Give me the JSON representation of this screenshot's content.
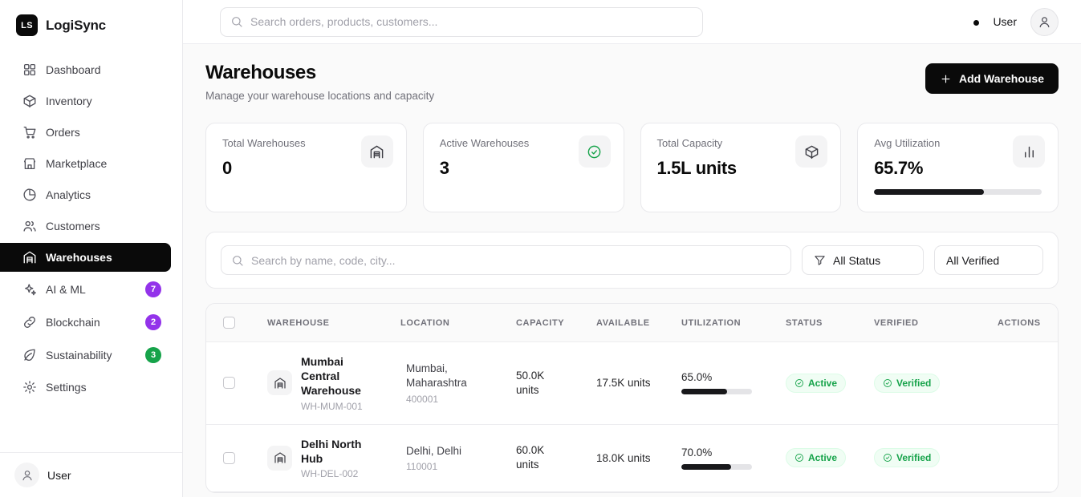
{
  "brand": {
    "logo": "LS",
    "name": "LogiSync"
  },
  "topbar": {
    "search_placeholder": "Search orders, products, customers...",
    "user_label": "User"
  },
  "sidebar": {
    "items": [
      {
        "label": "Dashboard"
      },
      {
        "label": "Inventory"
      },
      {
        "label": "Orders"
      },
      {
        "label": "Marketplace"
      },
      {
        "label": "Analytics"
      },
      {
        "label": "Customers"
      },
      {
        "label": "Warehouses",
        "active": true
      },
      {
        "label": "AI & ML",
        "badge": "7"
      },
      {
        "label": "Blockchain",
        "badge": "2"
      },
      {
        "label": "Sustainability",
        "badge": "3"
      },
      {
        "label": "Settings"
      }
    ],
    "footer_user": "User"
  },
  "page": {
    "title": "Warehouses",
    "subtitle": "Manage your warehouse locations and capacity",
    "add_button_label": "Add Warehouse"
  },
  "stats": [
    {
      "label": "Total Warehouses",
      "value": "0"
    },
    {
      "label": "Active Warehouses",
      "value": "3"
    },
    {
      "label": "Total Capacity",
      "value": "1.5L units"
    },
    {
      "label": "Avg Utilization",
      "value": "65.7%",
      "progress_pct": 65.7
    }
  ],
  "filters": {
    "search_placeholder": "Search by name, code, city...",
    "status": "All Status",
    "verified": "All Verified"
  },
  "table": {
    "headers": [
      "WAREHOUSE",
      "LOCATION",
      "CAPACITY",
      "AVAILABLE",
      "UTILIZATION",
      "STATUS",
      "VERIFIED",
      "ACTIONS"
    ],
    "rows": [
      {
        "name": "Mumbai Central Warehouse",
        "code": "WH-MUM-001",
        "location": "Mumbai, Maharashtra",
        "postal_code": "400001",
        "capacity": "50.0K units",
        "available": "17.5K units",
        "utilization": "65.0%",
        "utilization_pct": 65,
        "status": "Active",
        "verified": "Verified"
      },
      {
        "name": "Delhi North Hub",
        "code": "WH-DEL-002",
        "location": "Delhi, Delhi",
        "postal_code": "110001",
        "capacity": "60.0K units",
        "available": "18.0K units",
        "utilization": "70.0%",
        "utilization_pct": 70,
        "status": "Active",
        "verified": "Verified"
      }
    ]
  },
  "colors": {
    "accent_black": "#0a0a0a",
    "badge_purple": "#9333ea",
    "badge_green": "#16a34a",
    "status_pill_bg": "#f0fdf4",
    "status_pill_text": "#16a34a",
    "danger_red": "#dc2626",
    "progress_fill": "#18181b"
  }
}
